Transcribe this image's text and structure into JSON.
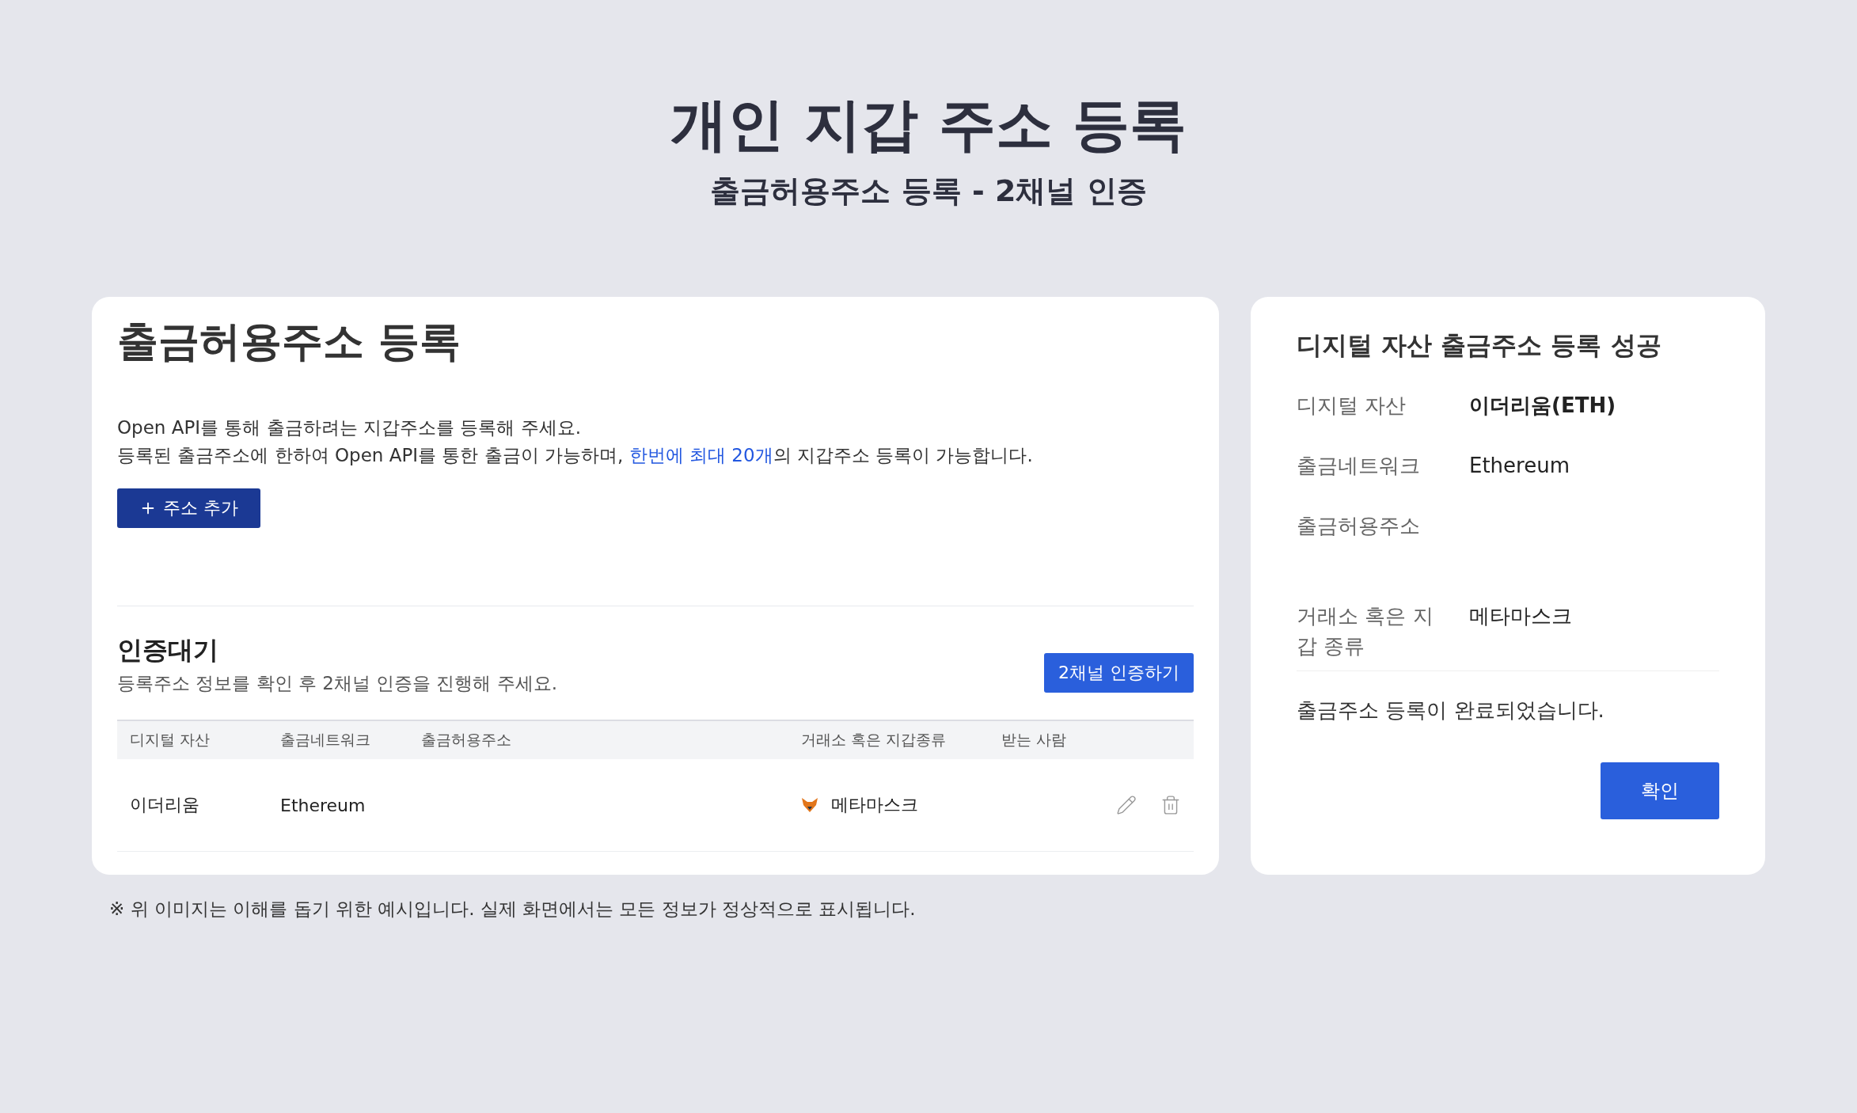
{
  "header": {
    "title": "개인 지갑 주소 등록",
    "subtitle": "출금허용주소 등록 - 2채널 인증"
  },
  "register_card": {
    "title": "출금허용주소 등록",
    "line_1": "Open API를 통해 출금하려는 지갑주소를 등록해 주세요.",
    "line_2_before": "등록된 출금주소에 한하여 Open API를 통한 출금이 가능하며, ",
    "line_2_link": "한번에 최대 20개",
    "line_2_after": "의 지갑주소 등록이 가능합니다.",
    "add_button": "주소 추가",
    "pending": {
      "title": "인증대기",
      "description": "등록주소 정보를 확인 후 2채널 인증을 진행해 주세요.",
      "verify_button": "2채널 인증하기",
      "table": {
        "columns": [
          "디지털 자산",
          "출금네트워크",
          "출금허용주소",
          "거래소 혹은 지갑종류",
          "받는 사람"
        ],
        "rows": [
          {
            "asset": "이더리움",
            "network": "Ethereum",
            "wallet": "메타마스크"
          }
        ]
      }
    }
  },
  "success_card": {
    "title": "디지털 자산 출금주소 등록 성공",
    "fields": [
      {
        "label": "디지털 자산",
        "value": "이더리움(ETH)",
        "kind": "bold"
      },
      {
        "label": "출금네트워크",
        "value": "Ethereum",
        "kind": "plain"
      },
      {
        "label": "출금허용주소",
        "kind": "empty"
      },
      {
        "label": "거래소 혹은 지갑 종류",
        "value": "메타마스크",
        "kind": "plain"
      }
    ],
    "message": "출금주소 등록이 완료되었습니다.",
    "confirm_button": "확인"
  },
  "footnote": "※ 위 이미지는 이해를 돕기 위한 예시입니다. 실제 화면에서는 모든 정보가 정상적으로 표시됩니다."
}
